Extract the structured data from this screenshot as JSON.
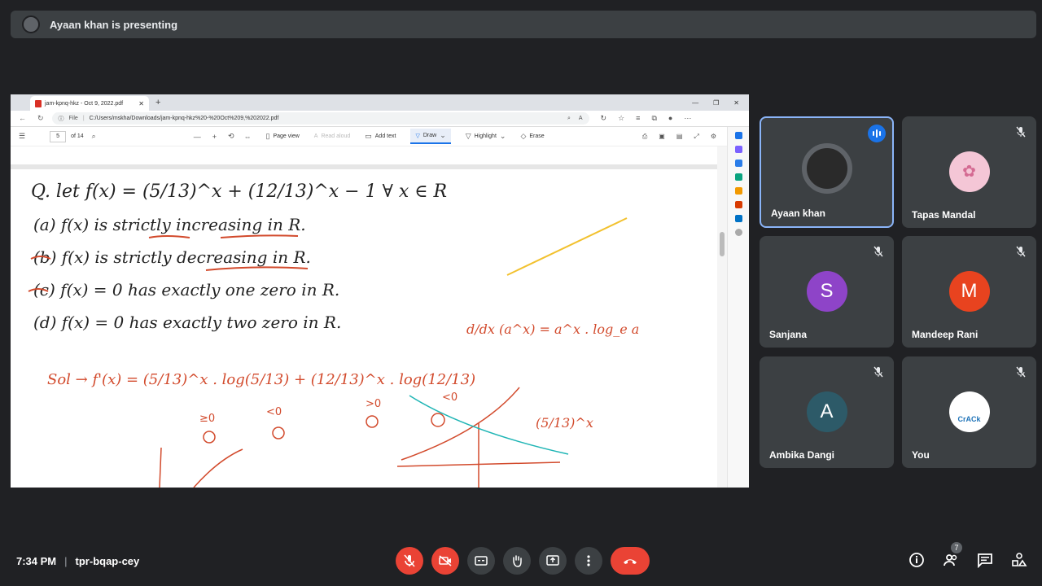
{
  "presenter_bar": {
    "text": "Ayaan khan is presenting"
  },
  "browser": {
    "tab_title": "jam-kpnq-hkz - Oct 9, 2022.pdf",
    "address_prefix": "File",
    "url": "C:/Users/mskha/Downloads/jam-kpnq-hkz%20-%20Oct%209,%202022.pdf"
  },
  "pdf_toolbar": {
    "page_number": "5",
    "page_count": "of 14",
    "page_view": "Page view",
    "read_aloud": "Read aloud",
    "add_text": "Add text",
    "draw": "Draw",
    "highlight": "Highlight",
    "erase": "Erase"
  },
  "handwritten_notes": {
    "question": "Q. let f(x) = (5/13)^x + (12/13)^x − 1   ∀ x ∈ R",
    "option_a": "(a) f(x) is strictly increasing in R.",
    "option_b": "(b) f(x) is strictly decreasing in R.",
    "option_c": "(c) f(x) = 0 has exactly one zero in R.",
    "option_d": "(d) f(x) = 0 has exactly two zero in R.",
    "derivative_rule": "d/dx (a^x) = a^x . log_e a",
    "solution": "Sol → f'(x) = (5/13)^x . log(5/13) + (12/13)^x . log(12/13)",
    "sign_1": "≥0",
    "sign_2": "<0",
    "sign_3": ">0",
    "sign_4": "<0",
    "graph_label": "(5/13)^x"
  },
  "participants": [
    {
      "name": "Ayaan khan",
      "avatar": "photo",
      "speaking": true,
      "muted": false
    },
    {
      "name": "Tapas Mandal",
      "avatar": "photo",
      "muted": true
    },
    {
      "name": "Sanjana",
      "avatar": "S",
      "avatar_color": "#8e44c8",
      "muted": true
    },
    {
      "name": "Mandeep Rani",
      "avatar": "M",
      "avatar_color": "#e8431f",
      "muted": true
    },
    {
      "name": "Ambika Dangi",
      "avatar": "A",
      "avatar_color": "#2d5a68",
      "muted": true
    },
    {
      "name": "You",
      "avatar": "logo",
      "logo_text": "CrACk",
      "muted": true
    }
  ],
  "meeting": {
    "time": "7:34 PM",
    "code": "tpr-bqap-cey",
    "participant_count": "7"
  },
  "controls": [
    "mic-off-icon",
    "camera-off-icon",
    "captions-icon",
    "raise-hand-icon",
    "present-icon",
    "more-icon",
    "end-call-icon"
  ],
  "right_controls": [
    "info-icon",
    "people-icon",
    "chat-icon",
    "activities-icon"
  ],
  "colors": {
    "background": "#202124",
    "tile": "#3c4043",
    "danger": "#ea4335",
    "accent": "#8ab4f8",
    "ink_black": "#222222",
    "ink_red": "#d24a2c",
    "ink_teal": "#1fb5b5",
    "ink_yellow": "#f2c12e"
  }
}
